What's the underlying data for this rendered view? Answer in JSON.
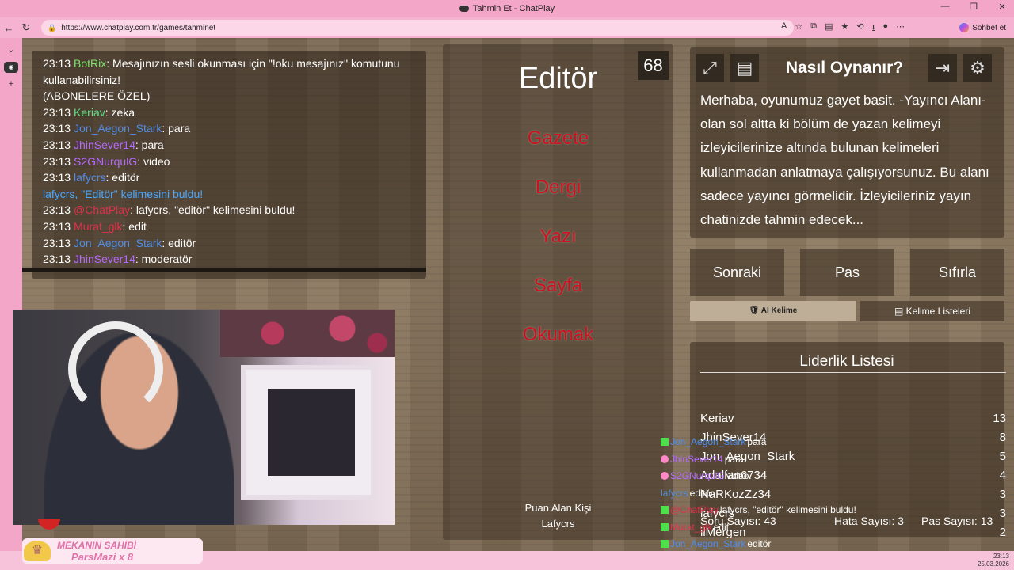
{
  "browser": {
    "tab_title": "Tahmin Et - ChatPlay",
    "url": "https://www.chatplay.com.tr/games/tahminet",
    "sohbet_label": "Sohbet et"
  },
  "chat": {
    "lines": [
      {
        "time": "23:13",
        "user": "BotRix",
        "color": "#7fe06b",
        "text": ": Mesajınızın sesli okunması için \"!oku mesajınız\" komutunu kullanabilirsiniz!"
      },
      {
        "time": "",
        "user": "",
        "color": "",
        "text": "(ABONELERE ÖZEL)"
      },
      {
        "time": "23:13",
        "user": "Keriav",
        "color": "#5fdc87",
        "text": ": zeka"
      },
      {
        "time": "23:13",
        "user": "Jon_Aegon_Stark",
        "color": "#4f8de8",
        "text": ": para"
      },
      {
        "time": "23:13",
        "user": "JhinSever14",
        "color": "#b46aff",
        "text": ": para"
      },
      {
        "time": "23:13",
        "user": "S2GNurqulG",
        "color": "#b46aff",
        "text": ": video"
      },
      {
        "time": "23:13",
        "user": "lafycrs",
        "color": "#4f8de8",
        "text": ": editör"
      }
    ],
    "system_line": "lafycrs, \"Editör\" kelimesini buldu!",
    "lines2": [
      {
        "time": "23:13",
        "user": "@ChatPlay",
        "color": "#e0304a",
        "text": ": lafycrs, \"editör\" kelimesini buldu!"
      },
      {
        "time": "23:13",
        "user": "Murat_glk",
        "color": "#e0304a",
        "text": ": edit"
      },
      {
        "time": "23:13",
        "user": "Jon_Aegon_Stark",
        "color": "#4f8de8",
        "text": ": editör"
      },
      {
        "time": "23:13",
        "user": "JhinSever14",
        "color": "#b46aff",
        "text": ": moderatör"
      }
    ]
  },
  "game": {
    "timer": "68",
    "word": "Editör",
    "taboo_words": [
      "Gazete",
      "Dergi",
      "Yazı",
      "Sayfa",
      "Okumak"
    ],
    "scorer_label": "Puan Alan Kişi",
    "scorer_name": "Lafycrs"
  },
  "howto": {
    "title": "Nasıl Oynanır?",
    "text": "Merhaba, oyunumuz gayet basit. -Yayıncı Alanı- olan sol altta ki bölüm de yazan kelimeyi izleyicilerinize altında bulunan kelimeleri kullanmadan anlatmaya çalışıyorsunuz. Bu alanı sadece yayıncı görmelidir. İzleyicileriniz yayın chatinizde tahmin edecek..."
  },
  "actions": {
    "next": "Sonraki",
    "pass": "Pas",
    "reset": "Sıfırla",
    "ai_word": "🛡 AI Kelime",
    "word_lists": "Kelime Listeleri"
  },
  "leaderboard": {
    "title": "Liderlik Listesi",
    "rows": [
      {
        "name": "Keriav",
        "score": "13"
      },
      {
        "name": "JhinSever14",
        "score": "8"
      },
      {
        "name": "Jon_Aegon_Stark",
        "score": "5"
      },
      {
        "name": "Adalfan6734",
        "score": "4"
      },
      {
        "name": "NaRKozZz34",
        "score": "3"
      },
      {
        "name": "lafycrs",
        "score": "3"
      },
      {
        "name": "ilMergen",
        "score": "2"
      }
    ],
    "questions": "Soru Sayısı: 43",
    "mistakes": "Hata Sayısı: 3",
    "passes": "Pas Sayısı: 13"
  },
  "overlay_chat": [
    {
      "badge": "k",
      "user": "Jon_Aegon_Stark",
      "color": "#4f8de8",
      "text": "para"
    },
    {
      "badge": "h",
      "user": "JhinSever14",
      "color": "#b46aff",
      "text": "para"
    },
    {
      "badge": "h",
      "user": "S2GNurqulG",
      "color": "#b46aff",
      "text": "video"
    },
    {
      "badge": "",
      "user": "lafycrs",
      "color": "#4f8de8",
      "text": "editör"
    },
    {
      "badge": "k",
      "user": "@ChatPlay",
      "color": "#e0304a",
      "text": "lafycrs, \"editör\" kelimesini buldu!"
    },
    {
      "badge": "k",
      "user": "Murat_glk",
      "color": "#e0304a",
      "text": "edit"
    },
    {
      "badge": "k",
      "user": "Jon_Aegon_Stark",
      "color": "#4f8de8",
      "text": "editör"
    },
    {
      "badge": "h",
      "user": "JhinSever14",
      "color": "#b46aff",
      "text": "moderatör"
    }
  ],
  "stream_overlay": {
    "owner_label": "MEKANIN SAHİBİ",
    "owner_name": "ParsMazi x 8"
  },
  "tray": {
    "time": "23:13",
    "date": "25.03.2026"
  }
}
